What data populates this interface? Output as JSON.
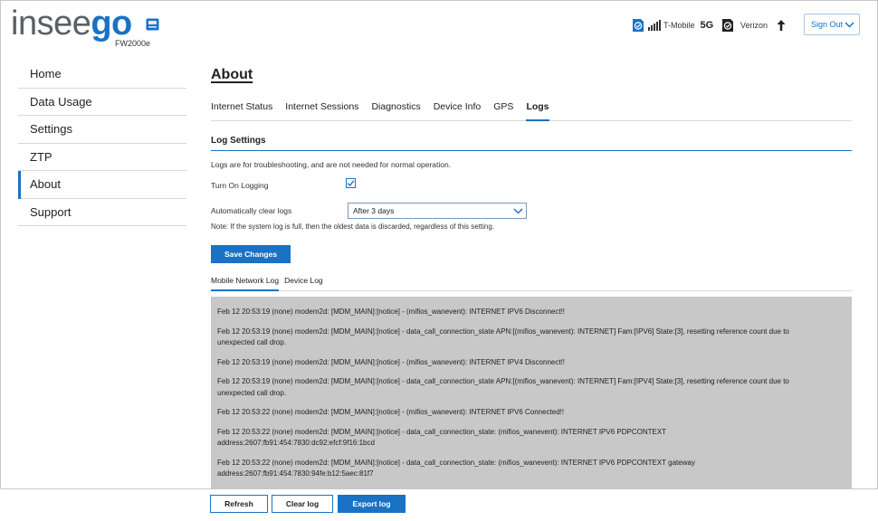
{
  "header": {
    "logo_main": "insee",
    "logo_accent": "go",
    "model": "FW2000e",
    "carrier1": {
      "name": "T-Mobile",
      "tech": "5G"
    },
    "carrier2": {
      "name": "Verizon"
    },
    "signout_label": "Sign Out"
  },
  "sidebar": {
    "items": [
      {
        "label": "Home"
      },
      {
        "label": "Data Usage"
      },
      {
        "label": "Settings"
      },
      {
        "label": "ZTP"
      },
      {
        "label": "About"
      },
      {
        "label": "Support"
      }
    ],
    "active": "About"
  },
  "main": {
    "title": "About",
    "tabs": [
      {
        "label": "Internet Status"
      },
      {
        "label": "Internet Sessions"
      },
      {
        "label": "Diagnostics"
      },
      {
        "label": "Device Info"
      },
      {
        "label": "GPS"
      },
      {
        "label": "Logs"
      }
    ],
    "active_tab": "Logs",
    "log_settings": {
      "title": "Log Settings",
      "description": "Logs are for troubleshooting, and are not needed for normal operation.",
      "turn_on_label": "Turn On Logging",
      "turn_on_checked": true,
      "auto_clear_label": "Automatically clear logs",
      "auto_clear_value": "After 3 days",
      "note": "Note: If the system log is full, then the oldest data is discarded, regardless of this setting.",
      "save_label": "Save Changes"
    },
    "subtabs": [
      {
        "label": "Mobile Network Log"
      },
      {
        "label": "Device Log"
      }
    ],
    "active_subtab": "Mobile Network Log",
    "log_lines": [
      "Feb 12 20:53:19 (none) modem2d: [MDM_MAIN]:[notice] - (mifios_wanevent): INTERNET IPV6 Disconnect!!",
      "Feb 12 20:53:19 (none) modem2d: [MDM_MAIN]:[notice] - data_call_connection_state APN:[(mifios_wanevent): INTERNET] Fam:[IPV6] State:[3], resetting reference count due to unexpected call drop.",
      "Feb 12 20:53:19 (none) modem2d: [MDM_MAIN]:[notice] - (mifios_wanevent): INTERNET IPV4 Disconnect!!",
      "Feb 12 20:53:19 (none) modem2d: [MDM_MAIN]:[notice] - data_call_connection_state APN:[(mifios_wanevent): INTERNET] Fam:[IPV4] State:[3], resetting reference count due to unexpected call drop.",
      "Feb 12 20:53:22 (none) modem2d: [MDM_MAIN]:[notice] - (mifios_wanevent): INTERNET IPV6 Connected!!",
      "Feb 12 20:53:22 (none) modem2d: [MDM_MAIN]:[notice] - data_call_connection_state: (mifios_wanevent): INTERNET IPV6 PDPCONTEXT address:2607:fb91:454:7830:dc92:efcf:9f16:1bcd",
      "Feb 12 20:53:22 (none) modem2d: [MDM_MAIN]:[notice] - data_call_connection_state: (mifios_wanevent): INTERNET IPV6 PDPCONTEXT gateway address:2607:fb91:454:7830:94fe:b12:5aec:81f7"
    ]
  },
  "footer": {
    "refresh_label": "Refresh",
    "clear_label": "Clear log",
    "export_label": "Export log"
  },
  "colors": {
    "accent": "#1a72c4",
    "log_background": "#c8c8c8"
  }
}
